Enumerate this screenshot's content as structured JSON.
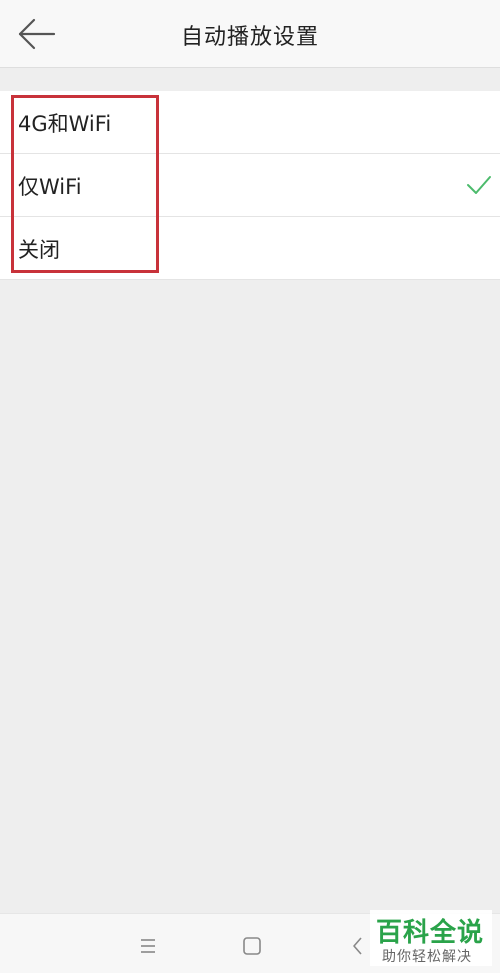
{
  "header": {
    "title": "自动播放设置",
    "back_icon": "arrow-left-icon"
  },
  "options": [
    {
      "label": "4G和WiFi",
      "selected": false
    },
    {
      "label": "仅WiFi",
      "selected": true
    },
    {
      "label": "关闭",
      "selected": false
    }
  ],
  "colors": {
    "check": "#4cbb6c",
    "highlight_box": "#c8323a",
    "watermark_green": "#2aa34a"
  },
  "navbar": {
    "menu_icon": "menu-icon",
    "home_icon": "square-home-icon",
    "back_icon": "chevron-left-icon"
  },
  "watermark": {
    "title": "百科全说",
    "subtitle": "助你轻松解决"
  }
}
